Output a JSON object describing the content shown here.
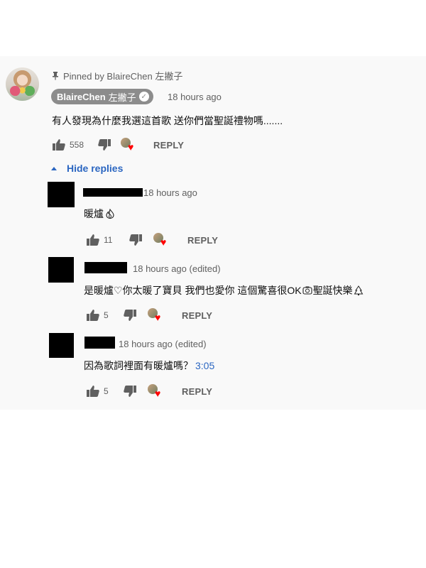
{
  "pinned": {
    "label": "Pinned by BlaireChen 左撇子"
  },
  "main_comment": {
    "author_name": "BlaireChen",
    "author_suffix": "左撇子",
    "timestamp": "18 hours ago",
    "text": "有人發現為什麼我選這首歌 送你們當聖誕禮物嗎.......",
    "likes": "558",
    "reply_label": "REPLY"
  },
  "hide_replies_label": "Hide replies",
  "replies": [
    {
      "meta": "18 hours ago",
      "text": "暖爐",
      "likes": "11",
      "reply_label": "REPLY"
    },
    {
      "meta": "18 hours ago (edited)",
      "text": "是暖爐♡你太暖了寶貝 我們也愛你 這個驚喜很OK",
      "text_tail": "聖誕快樂",
      "likes": "5",
      "reply_label": "REPLY"
    },
    {
      "meta": "18 hours ago (edited)",
      "text": "因為歌詞裡面有暖爐嗎？",
      "timestamp_link": "3:05",
      "likes": "5",
      "reply_label": "REPLY"
    }
  ],
  "colors": {
    "panel_bg": "#f9f9f9",
    "link": "#2b66c1",
    "muted": "#606060",
    "heart": "#ff0000",
    "owner_chip": "#8c8c8c"
  },
  "icons": [
    "pin-icon",
    "verified-check-icon",
    "thumb-up-icon",
    "thumb-down-icon",
    "creator-heart-icon",
    "caret-up-icon",
    "fire-emoji-icon",
    "camera-face-emoji-icon",
    "tree-emoji-icon"
  ]
}
